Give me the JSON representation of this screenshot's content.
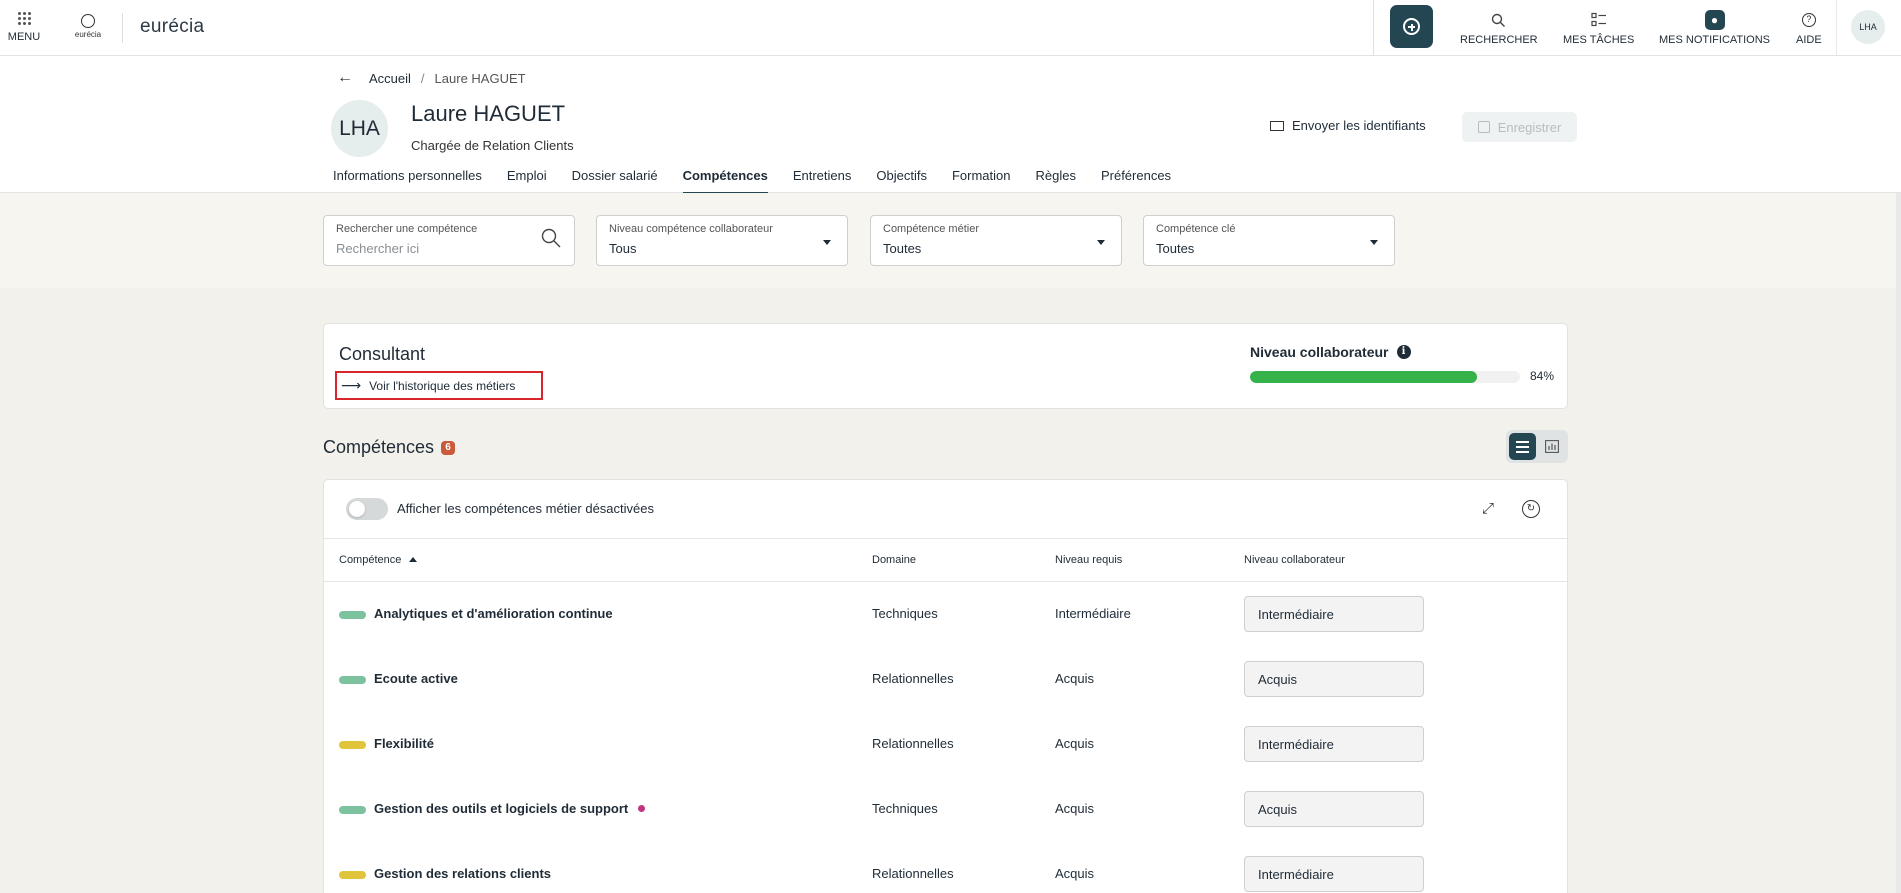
{
  "topbar": {
    "menu_label": "MENU",
    "logo_small_text": "eurécia",
    "logo_text": "eurécia",
    "nav": [
      {
        "label": "RECHERCHER",
        "icon": "search-icon"
      },
      {
        "label": "MES TÂCHES",
        "icon": "tasks-icon"
      },
      {
        "label": "MES NOTIFICATIONS",
        "icon": "bell-icon"
      },
      {
        "label": "AIDE",
        "icon": "help-icon"
      }
    ],
    "avatar": "LHA"
  },
  "header": {
    "breadcrumb": {
      "home": "Accueil",
      "separator": "/",
      "current": "Laure HAGUET"
    },
    "avatar": "LHA",
    "name": "Laure HAGUET",
    "role": "Chargée de Relation Clients",
    "send_label": "Envoyer les identifiants",
    "save_label": "Enregistrer",
    "tabs": [
      "Informations personnelles",
      "Emploi",
      "Dossier salarié",
      "Compétences",
      "Entretiens",
      "Objectifs",
      "Formation",
      "Règles",
      "Préférences"
    ],
    "active_tab": "Compétences"
  },
  "filters": {
    "search": {
      "label": "Rechercher une compétence",
      "placeholder": "Rechercher ici"
    },
    "niveau": {
      "label": "Niveau compétence collaborateur",
      "value": "Tous"
    },
    "metier": {
      "label": "Compétence métier",
      "value": "Toutes"
    },
    "cle": {
      "label": "Compétence clé",
      "value": "Toutes"
    }
  },
  "job": {
    "title": "Consultant",
    "history_link": "Voir l'historique des métiers",
    "niveau_label": "Niveau collaborateur",
    "niveau_percent": 84,
    "niveau_text": "84%"
  },
  "competences": {
    "title": "Compétences",
    "count": "6",
    "toggle_label": "Afficher les compétences métier désactivées",
    "columns": [
      "Compétence",
      "Domaine",
      "Niveau requis",
      "Niveau collaborateur"
    ],
    "rows": [
      {
        "name": "Analytiques et d'amélioration continue",
        "domain": "Techniques",
        "required": "Intermédiaire",
        "level": "Intermédiaire",
        "color": "#7cc29e",
        "dot": false
      },
      {
        "name": "Ecoute active",
        "domain": "Relationnelles",
        "required": "Acquis",
        "level": "Acquis",
        "color": "#7cc29e",
        "dot": false
      },
      {
        "name": "Flexibilité",
        "domain": "Relationnelles",
        "required": "Acquis",
        "level": "Intermédiaire",
        "color": "#e0c43a",
        "dot": false
      },
      {
        "name": "Gestion des outils et logiciels de support",
        "domain": "Techniques",
        "required": "Acquis",
        "level": "Acquis",
        "color": "#7cc29e",
        "dot": true
      },
      {
        "name": "Gestion des relations clients",
        "domain": "Relationnelles",
        "required": "Acquis",
        "level": "Intermédiaire",
        "color": "#e0c43a",
        "dot": false
      }
    ]
  },
  "colors": {
    "accent": "#244652",
    "progress": "#36b24a",
    "badge": "#c95a3a",
    "highlight_border": "#d7262c"
  }
}
